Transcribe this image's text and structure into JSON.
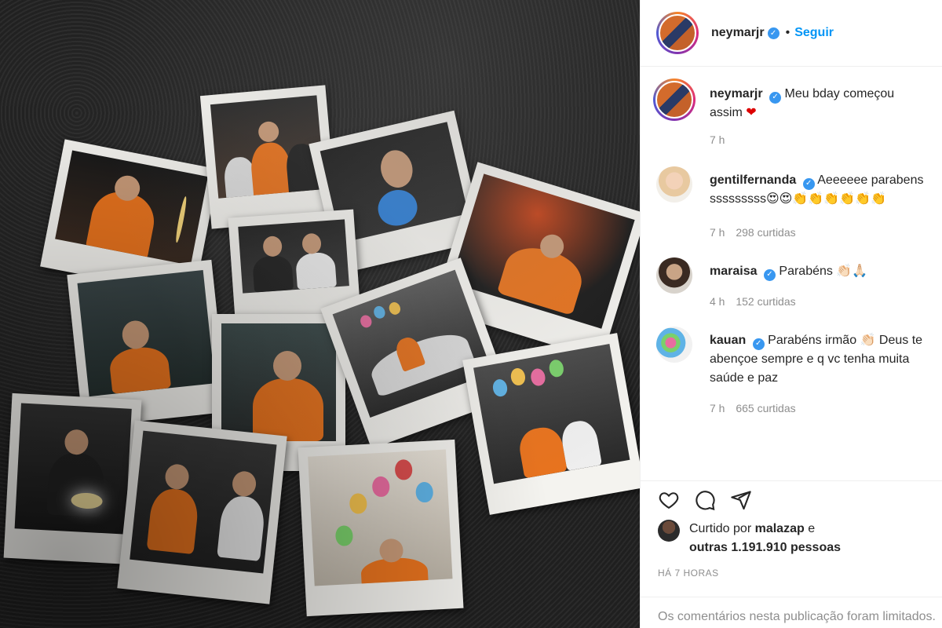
{
  "post": {
    "username": "neymarjr",
    "verified_icon": "verified-badge-icon",
    "dot": "•",
    "follow_label": "Seguir"
  },
  "caption": {
    "username": "neymarjr",
    "text": "Meu bday começou assim",
    "emoji": "❤",
    "time": "7 h"
  },
  "comments": [
    {
      "username": "gentilfernanda",
      "text": "Aeeeeee parabenssssssssss😍😍👏👏👏👏👏👏",
      "time": "7 h",
      "likes": "298 curtidas"
    },
    {
      "username": "maraisa",
      "text": "Parabéns 👏🏻🙏🏻",
      "time": "4 h",
      "likes": "152 curtidas"
    },
    {
      "username": "kauan",
      "text": "Parabéns irmão 👏🏻 Deus te abençoe sempre e q vc tenha muita saúde e paz",
      "time": "7 h",
      "likes": "665 curtidas"
    }
  ],
  "likes": {
    "prefix": "Curtido por",
    "user": "malazap",
    "conj": "e",
    "others": "outras 1.191.910 pessoas"
  },
  "timestamp": "HÁ 7 HORAS",
  "comments_closed": "Os comentários nesta publicação foram limitados.",
  "icons": [
    "heart-icon",
    "comment-icon",
    "share-icon"
  ],
  "colors": {
    "accent": "#0095f6",
    "muted": "#8e8e8e",
    "verified": "#3897f0"
  }
}
